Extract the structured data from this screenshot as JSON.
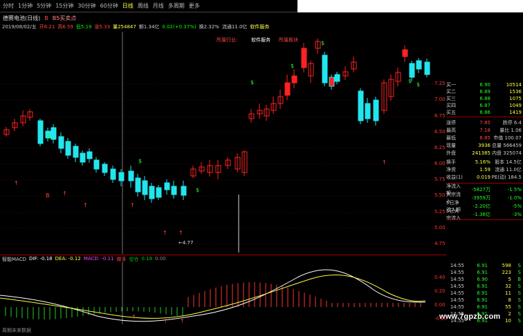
{
  "toolbar": {
    "items": [
      "分时",
      "1分钟",
      "5分钟",
      "15分钟",
      "30分钟",
      "60分钟",
      "日线",
      "周线",
      "月线",
      "多周期",
      "更多"
    ],
    "active_index": 6
  },
  "stock_line": {
    "name": "德赛电池(日线)",
    "badge": "B",
    "badge2": "B5买卖点"
  },
  "info_line": {
    "date": "2019/08/02/五",
    "open": "开6.21",
    "high": "高6.59",
    "low": "低5.19",
    "pct": "涨5.33",
    "vol": "量254847",
    "amount": "额1.34亿",
    "chg": "0.02(+0.37%)",
    "turn": "换2.32%",
    "circ": "流通11.0亿",
    "ind": "软件服务"
  },
  "sector": {
    "label": "所属行业:",
    "value": "软件服务",
    "right": "所属板块"
  },
  "price_axis": [
    "7.25",
    "7.00",
    "6.75",
    "6.50",
    "6.25",
    "6.00",
    "5.75",
    "5.50",
    "5.25",
    "5.00",
    "4.75"
  ],
  "orderbook": [
    {
      "label": "买一",
      "price": "6.90",
      "vol": "10514"
    },
    {
      "label": "买二",
      "price": "6.89",
      "vol": "1536"
    },
    {
      "label": "买三",
      "price": "6.88",
      "vol": "1075"
    },
    {
      "label": "买四",
      "price": "6.87",
      "vol": "1049"
    },
    {
      "label": "买五",
      "price": "6.86",
      "vol": "1419"
    }
  ],
  "quote": [
    {
      "a": "涨停",
      "b": "7.85",
      "c1": "跌停",
      "c": "6.4"
    },
    {
      "a": "最高",
      "b": "7.18",
      "c1": "量比",
      "c": "1.06"
    },
    {
      "a": "最低",
      "b": "6.85",
      "c1": "市值",
      "c": "100.07"
    },
    {
      "a": "现量",
      "b": "3936",
      "c1": "总量",
      "c": "566459"
    },
    {
      "a": "外盘",
      "b": "241385",
      "c1": "内盘",
      "c": "325074"
    },
    {
      "a": "换手",
      "b": "5.16%",
      "c1": "股本",
      "c": "14.5亿"
    },
    {
      "a": "净资",
      "b": "1.59",
      "c1": "流通",
      "c": "11.0亿"
    },
    {
      "a": "收益(1)",
      "b": "0.019",
      "c1": "PE(动)",
      "c": "184.5"
    }
  ],
  "flows": [
    {
      "label": "净流入额",
      "v": "-5827万",
      "p": "-1.5%"
    },
    {
      "label": "大宗流入",
      "v": "-3959万",
      "p": "-1.0%"
    },
    {
      "label": "5日净流入额",
      "v": "-2.20亿",
      "p": "-5%"
    },
    {
      "label": "5日大宗流入",
      "v": "-1.36亿",
      "p": "-3%"
    }
  ],
  "ticks": [
    {
      "t": "14:55",
      "p": "6.91",
      "v": "598",
      "f": "S"
    },
    {
      "t": "14:55",
      "p": "6.91",
      "v": "223",
      "f": "S"
    },
    {
      "t": "14:55",
      "p": "6.90",
      "v": "5",
      "f": "B"
    },
    {
      "t": "14:55",
      "p": "6.91",
      "v": "32",
      "f": "S"
    },
    {
      "t": "14:55",
      "p": "6.91",
      "v": "11",
      "f": "S"
    },
    {
      "t": "14:55",
      "p": "6.91",
      "v": "8",
      "f": "S"
    },
    {
      "t": "14:55",
      "p": "6.91",
      "v": "55",
      "f": "S"
    },
    {
      "t": "14:55",
      "p": "6.91",
      "v": "2",
      "f": "S"
    },
    {
      "t": "14:55",
      "p": "6.91",
      "v": "10",
      "f": "S"
    }
  ],
  "macd": {
    "title": "智能MACD",
    "dif": "DIF: -0.18",
    "dea": "DEA: -0.12",
    "macd": "MACD: -0.11",
    "buy": "做多",
    "sell": "空仓",
    "n1": "0.18",
    "n2": "0.00"
  },
  "macd_axis": [
    "0.40",
    "0.20",
    "0.00",
    "-0.20"
  ],
  "low_label": "←4.77",
  "bottom_text": "周期末来数据",
  "watermark": "www.7gpzb.com",
  "colors": {
    "up": "#ff2222",
    "down": "#22e5ee",
    "grid": "#880000",
    "dif": "#ffffff",
    "dea": "#ffff44"
  }
}
